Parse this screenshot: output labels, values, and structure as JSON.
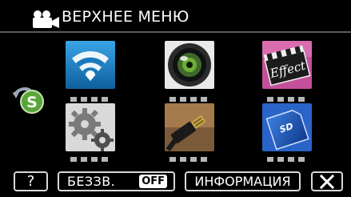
{
  "header": {
    "title": "ВЕРХНЕЕ МЕНЮ",
    "mode_icon": "video-camera-icon"
  },
  "side": {
    "switch_icon": "mode-switch-s-icon"
  },
  "menu_tiles": [
    {
      "icon": "wifi-icon"
    },
    {
      "icon": "video-quality-lens-icon"
    },
    {
      "icon": "effect-clapperboard-icon"
    },
    {
      "icon": "settings-gears-icon"
    },
    {
      "icon": "connection-cable-icon"
    },
    {
      "icon": "sd-card-media-icon"
    }
  ],
  "bottom_bar": {
    "help_label": "?",
    "mute_label": "БЕЗЗВ.",
    "mute_state": "OFF",
    "info_label": "ИНФОРМАЦИЯ",
    "close_icon": "close-x-icon"
  },
  "colors": {
    "background": "#000000",
    "text": "#ffffff",
    "button_border": "#d8d8d8",
    "wifi_tile": "#1b7fc3",
    "sd_tile": "#1d56b9"
  }
}
